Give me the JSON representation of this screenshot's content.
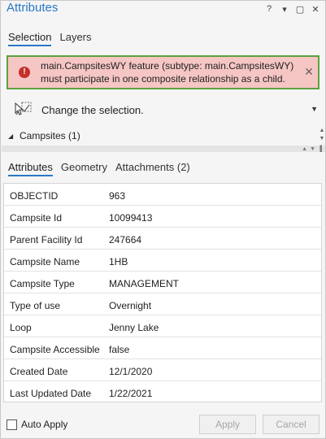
{
  "window": {
    "title": "Attributes",
    "controls": [
      "?",
      "▾",
      "▢",
      "✕"
    ]
  },
  "top_tabs": [
    {
      "label": "Selection",
      "active": true
    },
    {
      "label": "Layers",
      "active": false
    }
  ],
  "error": {
    "icon": "error-icon",
    "line1": "main.CampsitesWY feature (subtype: main.CampsitesWY)",
    "line2": "must participate in one composite relationship as a child.",
    "background": "#f5c6c4",
    "border": "#5aa23f"
  },
  "selection_tool": {
    "label": "Change the selection.",
    "icon": "selection-tool-icon"
  },
  "tree": {
    "label": "Campsites (1)"
  },
  "detail_tabs": [
    {
      "label": "Attributes",
      "active": true
    },
    {
      "label": "Geometry",
      "active": false
    },
    {
      "label": "Attachments (2)",
      "active": false
    }
  ],
  "attributes": [
    {
      "name": "OBJECTID",
      "value": "963"
    },
    {
      "name": "Campsite Id",
      "value": "10099413"
    },
    {
      "name": "Parent Facility Id",
      "value": "247664"
    },
    {
      "name": "Campsite Name",
      "value": "1HB"
    },
    {
      "name": "Campsite Type",
      "value": "MANAGEMENT"
    },
    {
      "name": "Type of use",
      "value": "Overnight"
    },
    {
      "name": "Loop",
      "value": "Jenny Lake"
    },
    {
      "name": "Campsite Accessible",
      "value": "false"
    },
    {
      "name": "Created Date",
      "value": "12/1/2020"
    },
    {
      "name": "Last Updated Date",
      "value": "1/22/2021"
    }
  ],
  "footer": {
    "auto_apply_label": "Auto Apply",
    "auto_apply_checked": false,
    "apply_label": "Apply",
    "cancel_label": "Cancel"
  },
  "colors": {
    "accent": "#2b78c6",
    "error_icon": "#c4302b"
  }
}
